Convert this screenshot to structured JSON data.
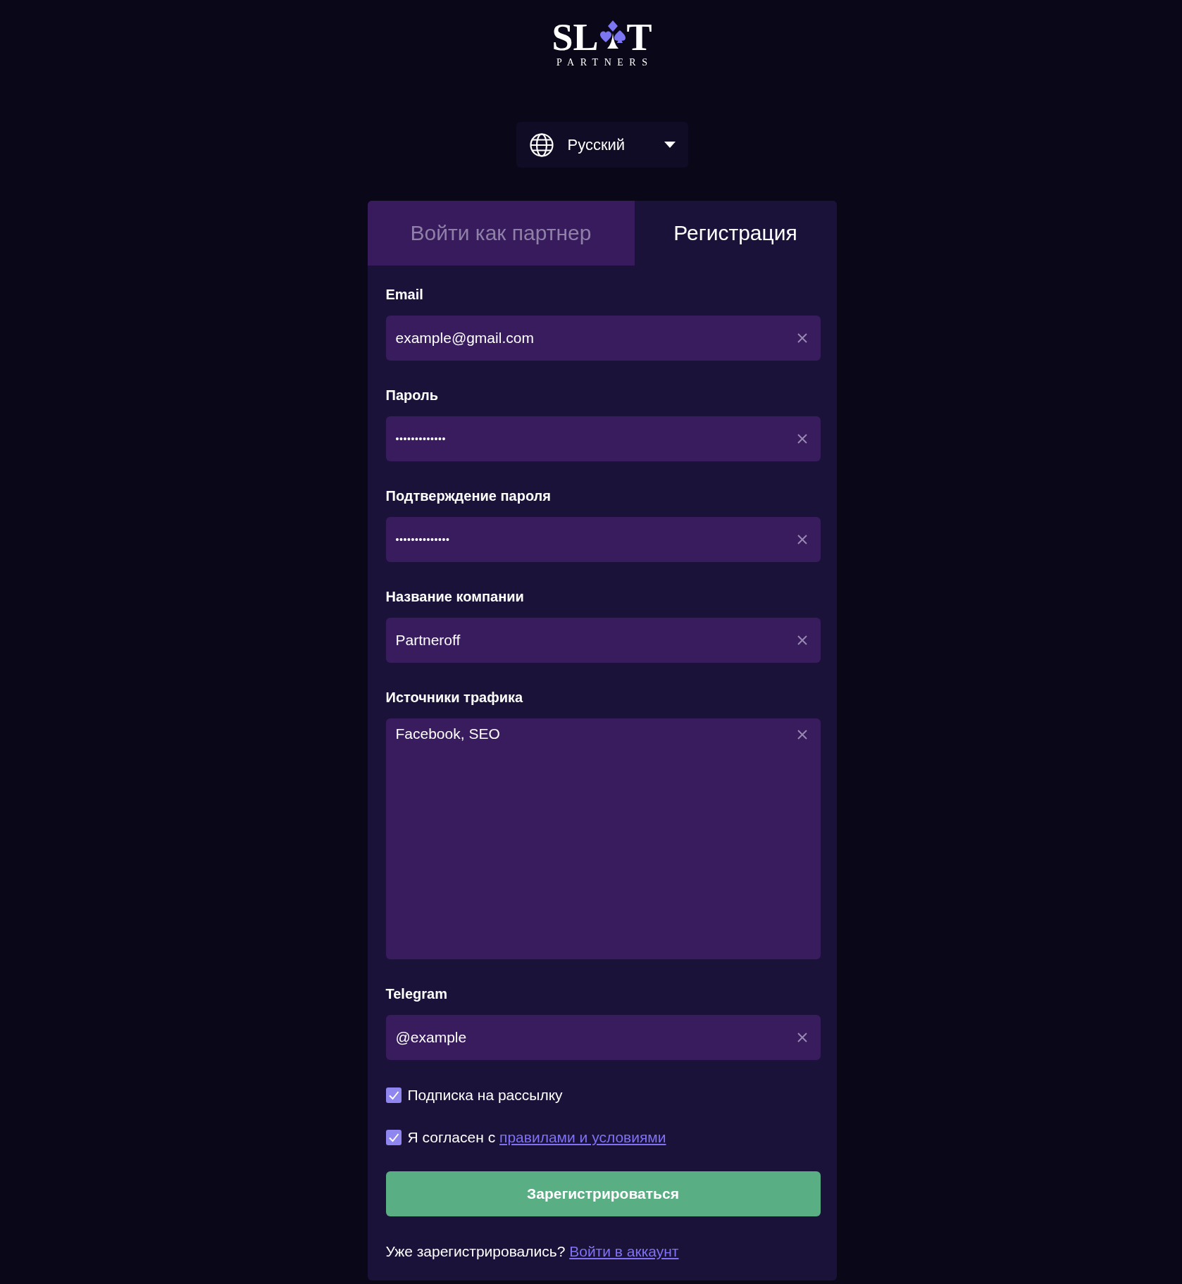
{
  "logo": {
    "wordmark_left": "SL",
    "wordmark_right": "T",
    "tagline": "PARTNERS"
  },
  "language_selector": {
    "label": "Русский"
  },
  "tabs": [
    {
      "label": "Войти как партнер",
      "selected": false
    },
    {
      "label": "Регистрация",
      "selected": true
    }
  ],
  "fields": [
    {
      "kind": "text",
      "label": "Email",
      "value": "example@gmail.com"
    },
    {
      "kind": "password",
      "label": "Пароль",
      "value": "•••••••••••••"
    },
    {
      "kind": "password",
      "label": "Подтверждение пароля",
      "value": "••••••••••••••"
    },
    {
      "kind": "text",
      "label": "Название компании",
      "value": "Partneroff"
    },
    {
      "kind": "textarea",
      "label": "Источники трафика",
      "value": "Facebook, SEO"
    },
    {
      "kind": "text",
      "label": "Telegram",
      "value": "@example"
    }
  ],
  "checkboxes": [
    {
      "label": "Подписка на рассылку",
      "checked": true
    },
    {
      "label": "Я согласен с",
      "link": "правилами и условиями",
      "checked": true
    }
  ],
  "submit_button": {
    "label": "Зарегистрироваться"
  },
  "footer": {
    "text": "Уже зарегистрировались?",
    "link": "Войти в аккаунт"
  }
}
